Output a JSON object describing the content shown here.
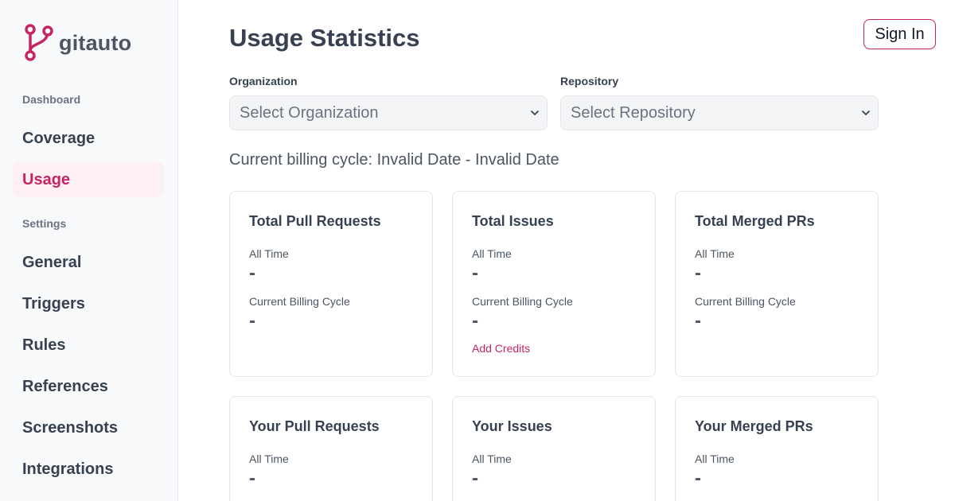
{
  "brand": {
    "name": "gitauto",
    "accent": "#c72466"
  },
  "sidebar": {
    "sections": [
      {
        "label": "Dashboard"
      },
      {
        "label": "Settings"
      }
    ],
    "items": [
      {
        "label": "Coverage"
      },
      {
        "label": "Usage",
        "active": true
      },
      {
        "label": "General"
      },
      {
        "label": "Triggers"
      },
      {
        "label": "Rules"
      },
      {
        "label": "References"
      },
      {
        "label": "Screenshots"
      },
      {
        "label": "Integrations"
      }
    ]
  },
  "header": {
    "title": "Usage Statistics",
    "sign_in_label": "Sign In"
  },
  "filters": {
    "organization": {
      "label": "Organization",
      "value": "Select Organization"
    },
    "repository": {
      "label": "Repository",
      "value": "Select Repository"
    }
  },
  "billing_cycle": "Current billing cycle: Invalid Date - Invalid Date",
  "cards": [
    {
      "title": "Total Pull Requests",
      "all_time_label": "All Time",
      "all_time_value": "-",
      "cycle_label": "Current Billing Cycle",
      "cycle_value": "-"
    },
    {
      "title": "Total Issues",
      "all_time_label": "All Time",
      "all_time_value": "-",
      "cycle_label": "Current Billing Cycle",
      "cycle_value": "-",
      "link": "Add Credits"
    },
    {
      "title": "Total Merged PRs",
      "all_time_label": "All Time",
      "all_time_value": "-",
      "cycle_label": "Current Billing Cycle",
      "cycle_value": "-"
    },
    {
      "title": "Your Pull Requests",
      "all_time_label": "All Time",
      "all_time_value": "-"
    },
    {
      "title": "Your Issues",
      "all_time_label": "All Time",
      "all_time_value": "-"
    },
    {
      "title": "Your Merged PRs",
      "all_time_label": "All Time",
      "all_time_value": "-"
    }
  ],
  "icons": {
    "logo": "git-branch-icon",
    "select_chevron": "chevron-down-icon"
  }
}
